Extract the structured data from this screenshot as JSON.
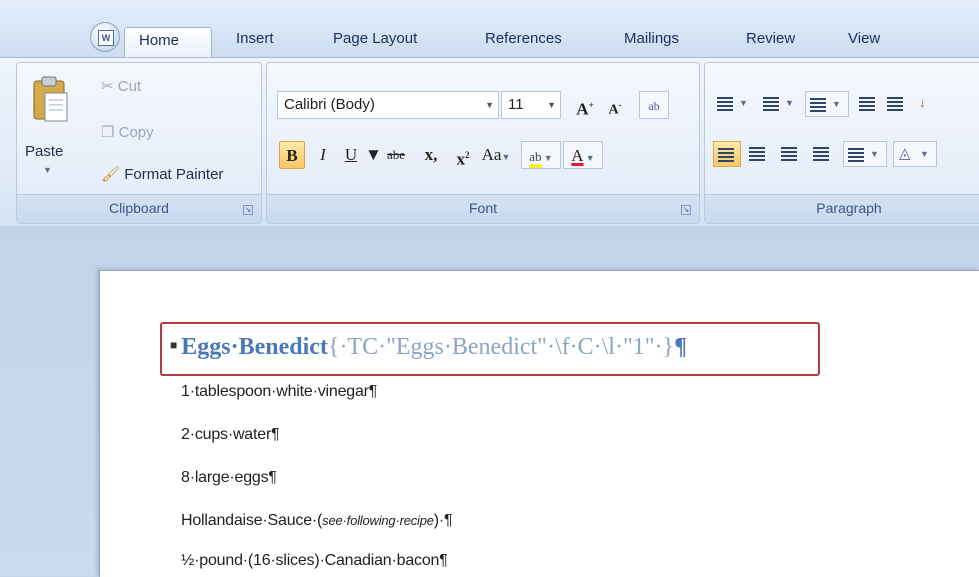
{
  "tabs": [
    "Home",
    "Insert",
    "Page Layout",
    "References",
    "Mailings",
    "Review",
    "View"
  ],
  "clipboard": {
    "paste": "Paste",
    "cut": "Cut",
    "copy": "Copy",
    "format_painter": "Format Painter",
    "group_label": "Clipboard"
  },
  "font": {
    "font_name": "Calibri (Body)",
    "font_size": "11",
    "grow": "A",
    "shrink": "A",
    "bold": "B",
    "italic": "I",
    "underline": "U",
    "strikethrough": "abe",
    "subscript": "x,",
    "superscript": "x",
    "change_case": "Aa",
    "highlight": "ab",
    "font_color": "A",
    "group_label": "Font"
  },
  "paragraph": {
    "group_label": "Paragraph"
  },
  "document": {
    "heading": "Eggs·Benedict",
    "field_code": "{·TC·\"Eggs·Benedict\"·\\f·C·\\l·\"1\"·}",
    "heading_mark": "¶",
    "lines": [
      "1·tablespoon·white·vinegar¶",
      "2·cups·water¶",
      "8·large·eggs¶",
      "Hollandaise·Sauce·(",
      "½·pound·(16·slices)·Canadian·bacon¶"
    ],
    "line4_italic": "see·following·recipe",
    "line4_tail": ")·¶"
  },
  "colors": {
    "accent_box": "#b23a42",
    "heading": "#4a79b8",
    "ribbon": "#dfe9f7"
  }
}
